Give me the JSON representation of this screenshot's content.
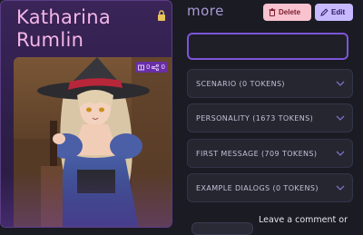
{
  "character": {
    "name": "Katharina Rumlin"
  },
  "stats": {
    "first_count": "0",
    "second_count": "0"
  },
  "header": {
    "title_fragment": "more"
  },
  "buttons": {
    "delete_label": "Delete",
    "edit_label": "Edit"
  },
  "sections": [
    {
      "label": "SCENARIO (0 TOKENS)"
    },
    {
      "label": "PERSONALITY (1673 TOKENS)"
    },
    {
      "label": "FIRST MESSAGE (709 TOKENS)"
    },
    {
      "label": "EXAMPLE DIALOGS (0 TOKENS)"
    }
  ],
  "footer": {
    "comment_prompt": "Leave a comment or"
  },
  "colors": {
    "name": "#f3b6e6",
    "card_bg": "#3a2458",
    "accent": "#7d55d9",
    "delete_bg": "#f8c2cf",
    "edit_bg": "#c7b9ff"
  },
  "icons": [
    "lock-icon",
    "book-icon",
    "share-icon",
    "trash-icon",
    "pencil-icon",
    "chevron-down-icon"
  ]
}
